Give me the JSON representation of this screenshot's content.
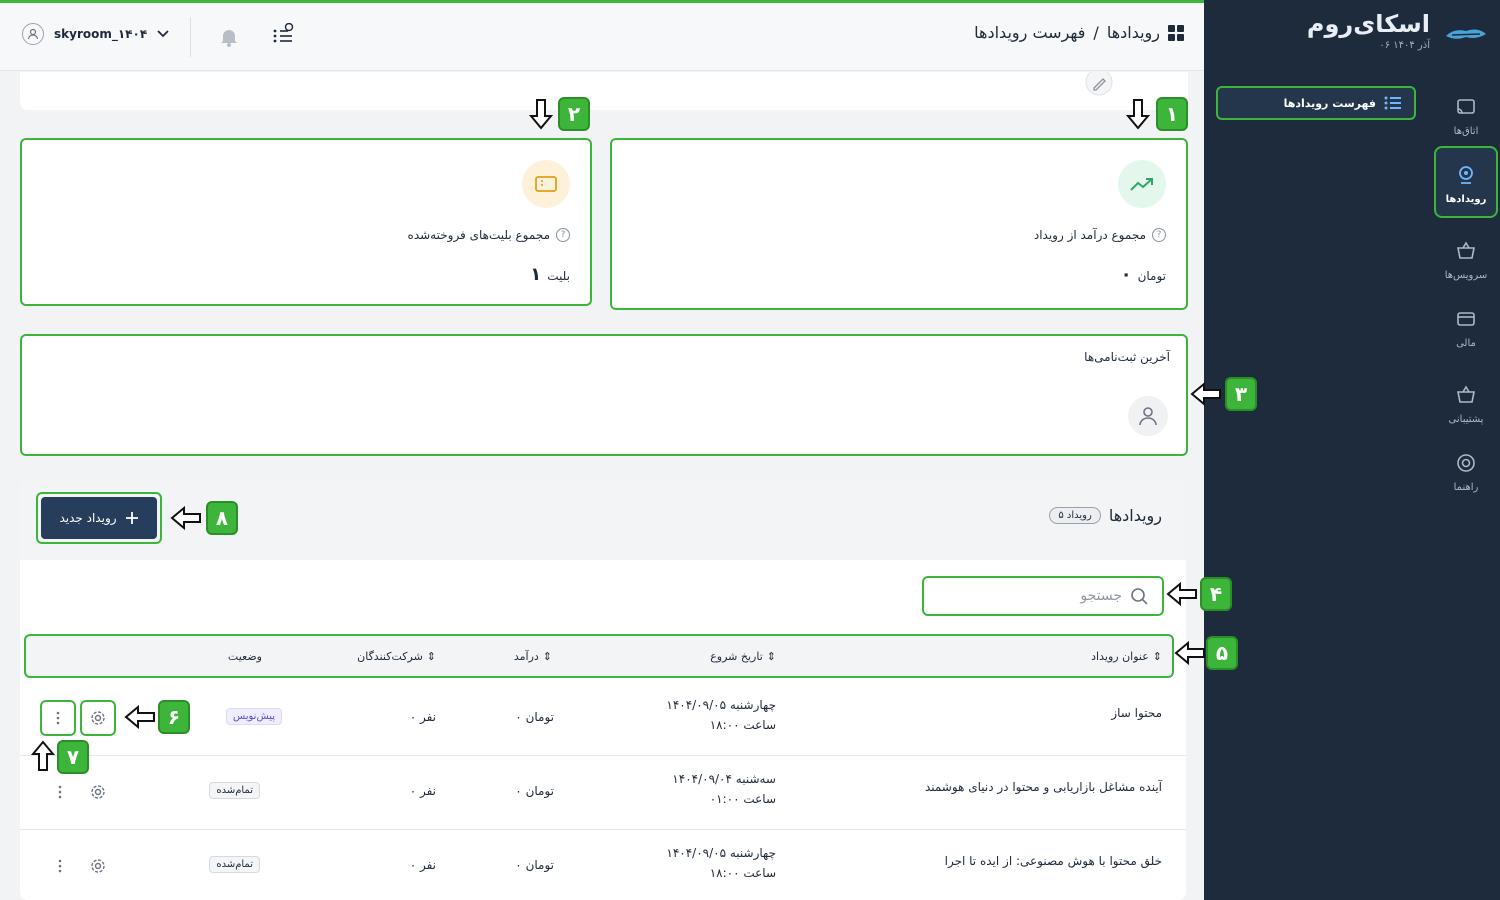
{
  "sidebar": {
    "brand_name": "اسکای‌روم",
    "brand_date": "۰۶ آذر ۱۴۰۴",
    "items": [
      {
        "label": "اتاق‌ها",
        "icon": "cast-icon"
      },
      {
        "label": "رویدادها",
        "icon": "location-icon",
        "active": true
      },
      {
        "label": "سرویس‌ها",
        "icon": "basket-icon"
      },
      {
        "label": "مالی",
        "icon": "card-icon"
      },
      {
        "label": "پشتیبانی",
        "icon": "basket-icon"
      },
      {
        "label": "راهنما",
        "icon": "lifebuoy-icon"
      }
    ],
    "submenu_label": "فهرست رویدادها"
  },
  "header": {
    "breadcrumb_root": "رویدادها",
    "breadcrumb_sep": "/",
    "breadcrumb_current": "فهرست رویدادها",
    "username": "skyroom_۱۴۰۴"
  },
  "stats": {
    "revenue_label": "مجموع درآمد از رویداد",
    "revenue_value": "۰",
    "revenue_unit": "تومان",
    "tickets_label": "مجموع بلیت‌های فروخته‌شده",
    "tickets_value": "۱",
    "tickets_unit": "بلیت"
  },
  "registrations": {
    "title": "آخرین ثبت‌نامی‌ها"
  },
  "events": {
    "title": "رویدادها",
    "count_badge": "۵ رویداد",
    "new_button": "رویداد جدید",
    "search_placeholder": "جستجو",
    "columns": {
      "title": "عنوان رویداد",
      "start": "تاریخ شروع",
      "revenue": "درآمد",
      "participants": "شرکت‌کنندگان",
      "status": "وضعیت"
    },
    "rows": [
      {
        "title": "محتوا ساز",
        "date": "چهارشنبه ۱۴۰۴/۰۹/۰۵",
        "time": "ساعت ۱۸:۰۰",
        "revenue": "۰ تومان",
        "participants": "۰ نفر",
        "status": "پیش‌نویس"
      },
      {
        "title": "آینده مشاغل بازاریابی و محتوا در دنیای هوشمند",
        "date": "سه‌شنبه ۱۴۰۴/۰۹/۰۴",
        "time": "ساعت ۰۱:۰۰",
        "revenue": "۰ تومان",
        "participants": "۰ نفر",
        "status": "تمام‌شده"
      },
      {
        "title": "خلق محتوا با هوش مصنوعی: از ایده تا اجرا",
        "date": "چهارشنبه ۱۴۰۴/۰۹/۰۵",
        "time": "ساعت ۱۸:۰۰",
        "revenue": "۰ تومان",
        "participants": "۰ نفر",
        "status": "تمام‌شده"
      }
    ]
  },
  "callouts": [
    "۱",
    "۲",
    "۳",
    "۴",
    "۵",
    "۶",
    "۷",
    "۸"
  ],
  "colors": {
    "accent": "#3db53a",
    "sidebar": "#1d2b3d",
    "primary_button": "#263e5c"
  }
}
